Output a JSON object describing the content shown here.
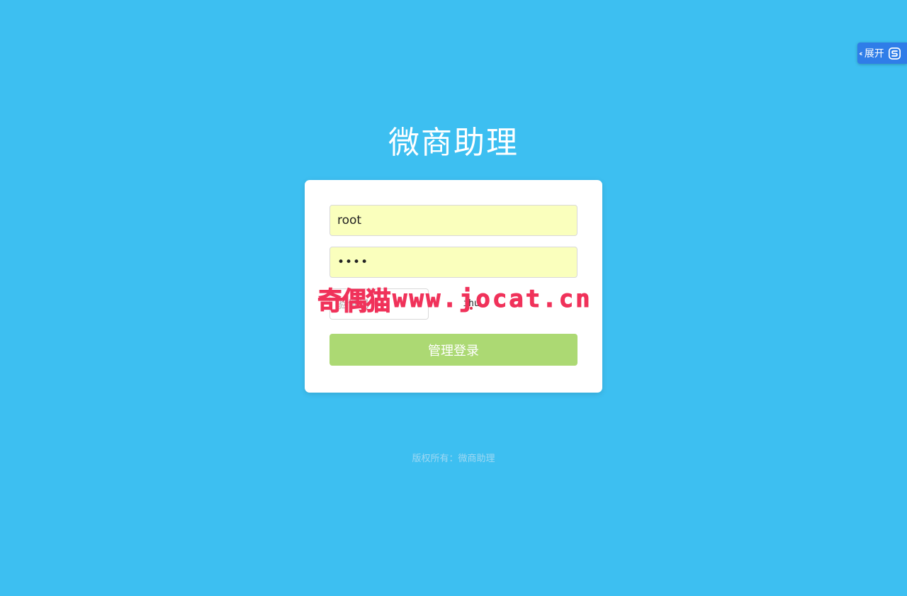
{
  "app": {
    "title": "微商助理"
  },
  "login_form": {
    "username_value": "root",
    "password_value": "abcd",
    "captcha_placeholder": "验证码",
    "captcha_text": "ihu",
    "submit_label": "管理登录"
  },
  "watermark": {
    "brand": "奇偶猫",
    "url": "www.jocat.cn"
  },
  "footer": {
    "copyright": "版权所有：微商助理"
  },
  "side_widget": {
    "label": "展开",
    "chevron": "‹‹",
    "icon": "translate-logo-icon"
  },
  "colors": {
    "background": "#3dbff1",
    "autofill": "#faffbd",
    "button": "#acd973",
    "watermark": "#f0325a",
    "widget": "#2f7de8"
  }
}
